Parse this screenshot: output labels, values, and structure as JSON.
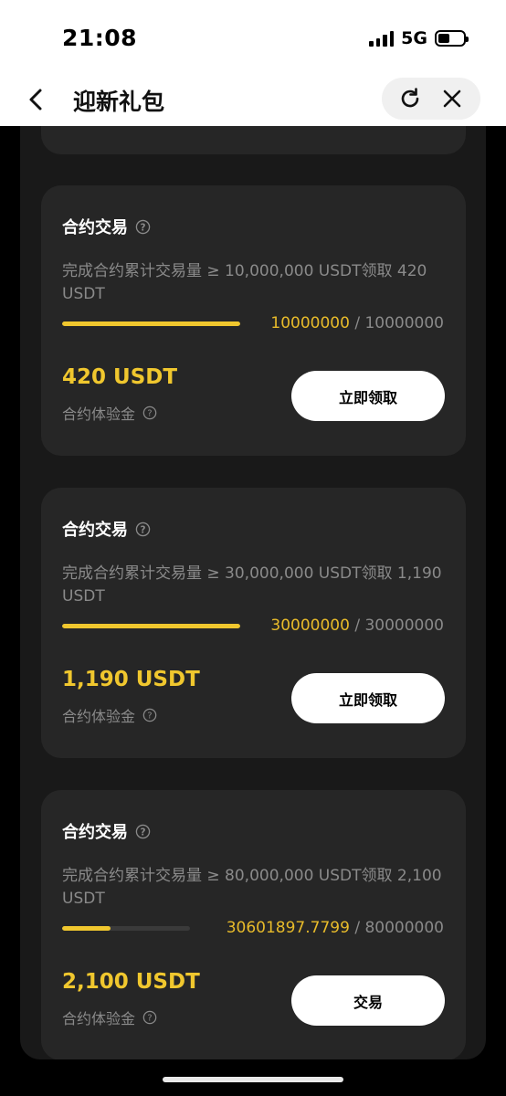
{
  "status_bar": {
    "time": "21:08",
    "network": "5G"
  },
  "header": {
    "title": "迎新礼包"
  },
  "tasks": [
    {
      "title": "合约交易",
      "description": "完成合约累计交易量 ≥ 10,000,000 USDT领取 420 USDT",
      "progress_current": "10000000",
      "progress_total": "/ 10000000",
      "progress_fraction": 1.0,
      "reward_amount": "420 USDT",
      "reward_label": "合约体验金",
      "button_label": "立即领取"
    },
    {
      "title": "合约交易",
      "description": "完成合约累计交易量 ≥ 30,000,000 USDT领取 1,190 USDT",
      "progress_current": "30000000",
      "progress_total": "/ 30000000",
      "progress_fraction": 1.0,
      "reward_amount": "1,190 USDT",
      "reward_label": "合约体验金",
      "button_label": "立即领取"
    },
    {
      "title": "合约交易",
      "description": "完成合约累计交易量 ≥ 80,000,000 USDT领取 2,100 USDT",
      "progress_current": "30601897.7799",
      "progress_total": "/ 80000000",
      "progress_fraction": 0.38,
      "reward_amount": "2,100 USDT",
      "reward_label": "合约体验金",
      "button_label": "交易"
    }
  ],
  "icons": {
    "back": "chevron-left-icon",
    "refresh": "refresh-icon",
    "close": "close-icon",
    "help": "question-circle-icon"
  },
  "colors": {
    "accent": "#f0c72e",
    "card_bg": "#262626",
    "page_bg": "#191919",
    "muted_text": "#8a8a8a"
  }
}
